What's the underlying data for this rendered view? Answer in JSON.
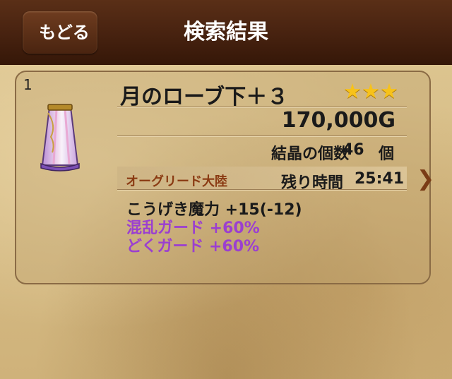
{
  "header": {
    "back_label": "もどる",
    "title": "検索結果"
  },
  "item": {
    "index": "1",
    "name": "月のローブ下＋３",
    "stars": "★★★",
    "price": "170,000G",
    "crystal_label": "結晶の個数",
    "crystal_count": "46",
    "crystal_unit": "個",
    "region": "オーグリード大陸",
    "time_label": "残り時間",
    "time_remaining": "25:41",
    "icon": "robe-bottom-icon",
    "stats": [
      "こうげき魔力 +15(-12)",
      "混乱ガード +60%",
      "どくガード +60%"
    ]
  },
  "colors": {
    "header_bg": "#4a2411",
    "star": "#f7c21a",
    "region_text": "#8a3a12",
    "purple_stat": "#9b3fd0",
    "arrow": "#7a3c16"
  }
}
